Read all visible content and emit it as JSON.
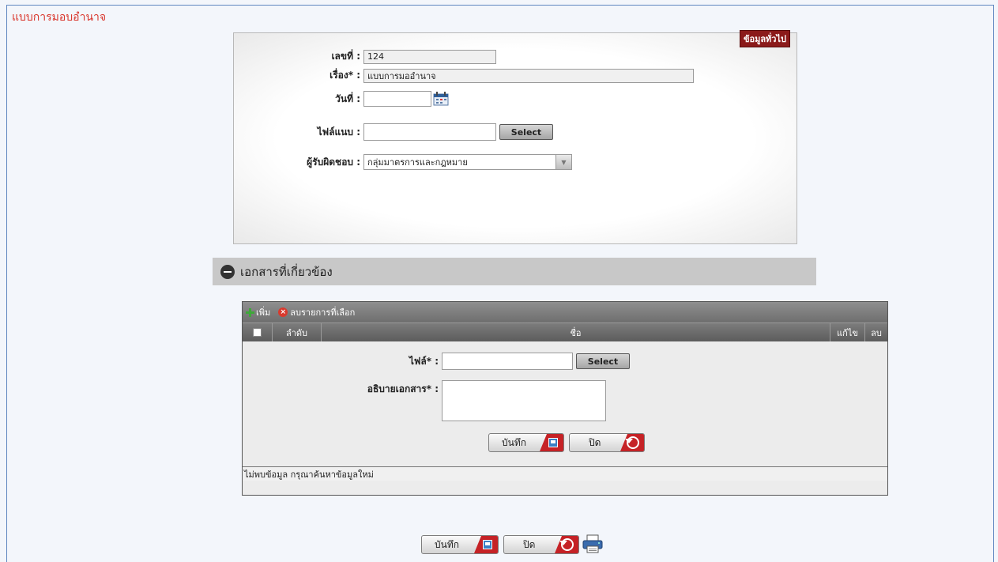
{
  "page": {
    "title": "แบบการมอบอำนาจ"
  },
  "info_panel": {
    "badge": "ข้อมูลทั่วไป",
    "fields": {
      "number_label": "เลขที่ :",
      "number_value": "124",
      "subject_label": "เรื่อง* :",
      "subject_value": "แบบการมออำนาจ",
      "date_label": "วันที่ :",
      "date_value": "",
      "attachment_label": "ไฟล์แนบ :",
      "attachment_value": "",
      "attachment_button": "Select",
      "owner_label": "ผู้รับผิดชอบ :",
      "owner_value": "กลุ่มมาตรการและกฎหมาย"
    }
  },
  "related_docs": {
    "title": "เอกสารที่เกี่ยวข้อง",
    "toolbar": {
      "add_label": "เพิ่ม",
      "delete_selected_label": "ลบรายการที่เลือก"
    },
    "columns": {
      "order": "ลำดับ",
      "name": "ชื่อ",
      "edit": "แก้ไข",
      "delete": "ลบ"
    },
    "form": {
      "file_label": "ไฟล์* :",
      "file_button": "Select",
      "description_label": "อธิบายเอกสาร* :",
      "save_label": "บันทึก",
      "close_label": "ปิด"
    },
    "empty_message": "ไม่พบข้อมูล กรุณาค้นหาข้อมูลใหม่"
  },
  "footer_actions": {
    "save_label": "บันทึก",
    "close_label": "ปิด"
  },
  "icons": [
    "calendar-icon",
    "dropdown-arrow-icon",
    "minus-circle-icon",
    "plus-icon",
    "delete-circle-icon",
    "save-icon",
    "undo-icon",
    "printer-icon"
  ],
  "colors": {
    "title_red": "#d9342a",
    "badge_bg": "#8b1a1a",
    "button_accent": "#c52226",
    "frame_border": "#5f87c0"
  }
}
